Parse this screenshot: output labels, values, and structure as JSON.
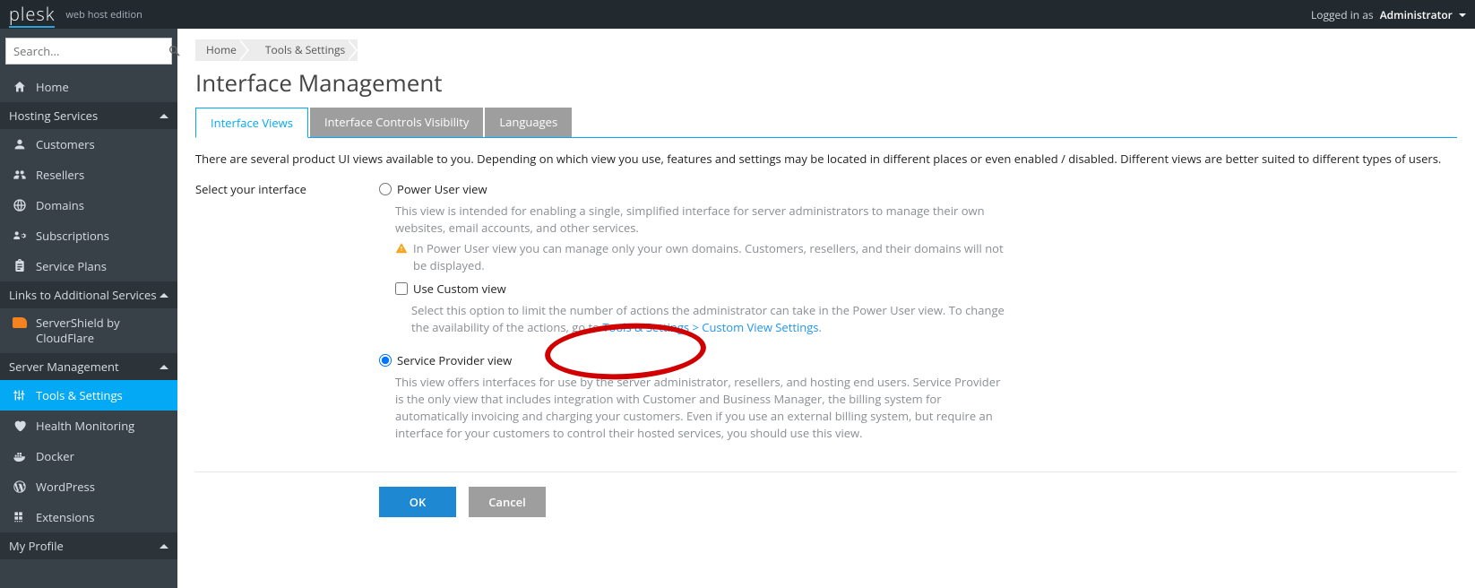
{
  "header": {
    "brand": "plesk",
    "edition": "web host edition",
    "logged_in_as_label": "Logged in as",
    "username": "Administrator"
  },
  "sidebar": {
    "search_placeholder": "Search...",
    "sections": [
      {
        "title": null,
        "items": [
          {
            "label": "Home",
            "icon": "home-icon"
          }
        ]
      },
      {
        "title": "Hosting Services",
        "items": [
          {
            "label": "Customers",
            "icon": "user-icon"
          },
          {
            "label": "Resellers",
            "icon": "users-icon"
          },
          {
            "label": "Domains",
            "icon": "globe-icon"
          },
          {
            "label": "Subscriptions",
            "icon": "gear-icon"
          },
          {
            "label": "Service Plans",
            "icon": "clipboard-icon"
          }
        ]
      },
      {
        "title": "Links to Additional Services",
        "items": [
          {
            "label": "ServerShield by CloudFlare",
            "icon": "cloudflare-icon"
          }
        ]
      },
      {
        "title": "Server Management",
        "items": [
          {
            "label": "Tools & Settings",
            "icon": "sliders-icon",
            "active": true
          },
          {
            "label": "Health Monitoring",
            "icon": "heart-icon"
          },
          {
            "label": "Docker",
            "icon": "docker-icon"
          },
          {
            "label": "WordPress",
            "icon": "wordpress-icon"
          },
          {
            "label": "Extensions",
            "icon": "grid-icon"
          }
        ]
      },
      {
        "title": "My Profile",
        "items": []
      }
    ]
  },
  "breadcrumb": [
    {
      "label": "Home"
    },
    {
      "label": "Tools & Settings"
    }
  ],
  "page": {
    "title": "Interface Management",
    "tabs": [
      {
        "label": "Interface Views",
        "active": true
      },
      {
        "label": "Interface Controls Visibility"
      },
      {
        "label": "Languages"
      }
    ],
    "intro": "There are several product UI views available to you. Depending on which view you use, features and settings may be located in different places or even enabled / disabled. Different views are better suited to different types of users.",
    "form_label": "Select your interface",
    "options": {
      "power_user": {
        "label": "Power User view",
        "desc": "This view is intended for enabling a single, simplified interface for server administrators to manage their own websites, email accounts, and other services.",
        "warning": "In Power User view you can manage only your own domains. Customers, resellers, and their domains will not be displayed.",
        "custom": {
          "label": "Use Custom view",
          "desc_pre": "Select this option to limit the number of actions the administrator can take in the Power User view. To change the availability of the actions, go to ",
          "link": "Tools & Settings > Custom View Settings",
          "desc_post": "."
        }
      },
      "service_provider": {
        "label": "Service Provider view",
        "desc": "This view offers interfaces for use by the server administrator, resellers, and hosting end users. Service Provider is the only view that includes integration with Customer and Business Manager, the billing system for automatically invoicing and charging your customers. Even if you use an external billing system, but require an interface for your customers to control their hosted services, you should use this view."
      }
    },
    "buttons": {
      "ok": "OK",
      "cancel": "Cancel"
    }
  }
}
